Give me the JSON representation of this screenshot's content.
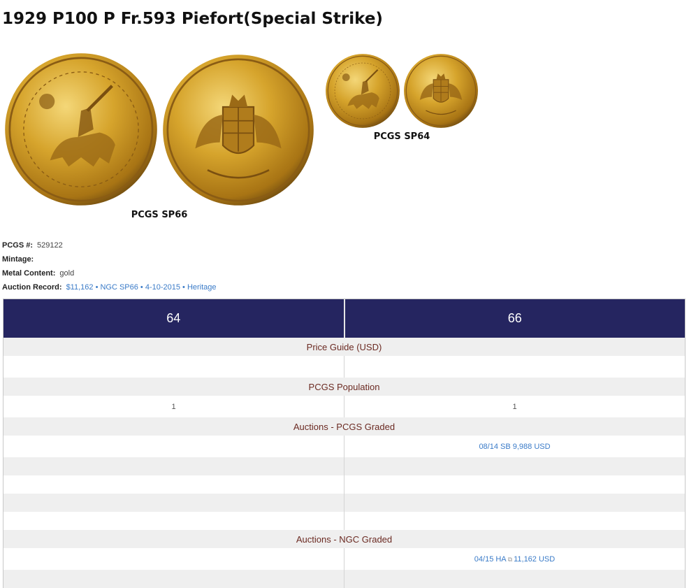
{
  "page": {
    "title": "1929 P100 P Fr.593 Piefort(Special Strike)"
  },
  "images": [
    {
      "grade_label": "PCGS SP66",
      "obverse_icon": "coin-obverse-knight-icon",
      "reverse_icon": "coin-reverse-shield-icon"
    },
    {
      "grade_label": "PCGS SP64",
      "obverse_icon": "coin-obverse-knight-icon",
      "reverse_icon": "coin-reverse-shield-icon"
    }
  ],
  "details": {
    "pcgs_label": "PCGS #:",
    "pcgs_value": "529122",
    "mintage_label": "Mintage:",
    "mintage_value": "",
    "metal_label": "Metal Content:",
    "metal_value": "gold",
    "auction_label": "Auction Record:",
    "auction_value": "$11,162 • NGC SP66 • 4-10-2015 • Heritage"
  },
  "table": {
    "grades": [
      "64",
      "66"
    ],
    "sections": {
      "price_guide": "Price Guide (USD)",
      "population": "PCGS Population",
      "auctions_pcgs": "Auctions - PCGS Graded",
      "auctions_ngc": "Auctions - NGC Graded"
    },
    "population": [
      "1",
      "1"
    ],
    "auctions_pcgs_rows": [
      [
        "",
        "08/14 SB 9,988 USD"
      ],
      [
        "",
        ""
      ],
      [
        "",
        ""
      ],
      [
        "",
        ""
      ],
      [
        "",
        ""
      ]
    ],
    "auctions_ngc": {
      "col66_prefix": "04/15 HA",
      "col66_suffix": "11,162 USD",
      "external_icon": "external-link-icon"
    }
  },
  "colors": {
    "header_bg": "#252560",
    "section_text": "#6b2a22",
    "link": "#3a7bc8",
    "row_grey": "#efefef",
    "gold": "#d8a830"
  }
}
